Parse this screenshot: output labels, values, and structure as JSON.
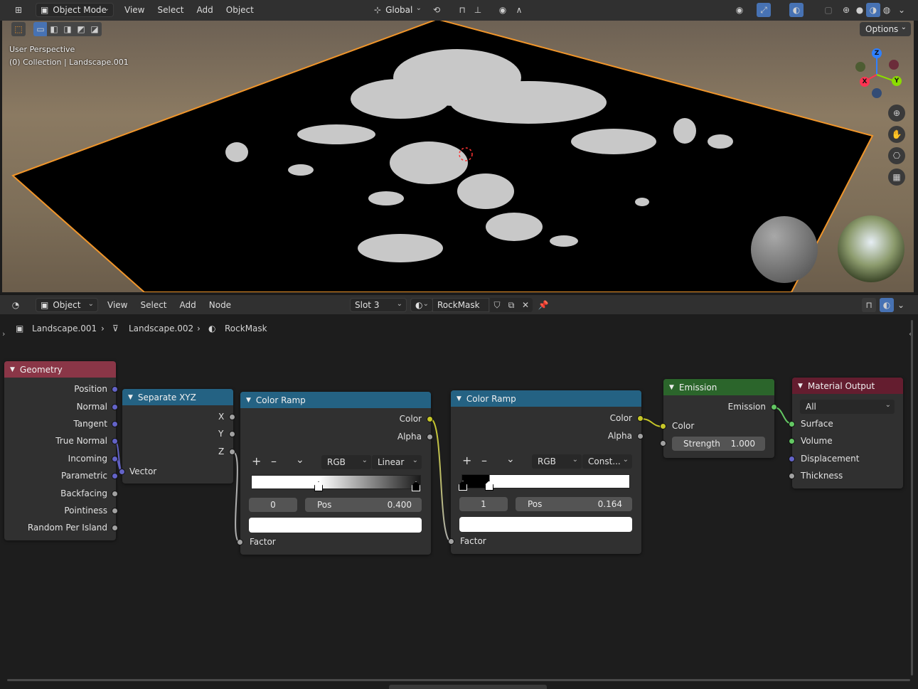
{
  "viewport_header": {
    "mode": "Object Mode",
    "menus": [
      "View",
      "Select",
      "Add",
      "Object"
    ],
    "orientation": "Global",
    "options": "Options"
  },
  "viewport": {
    "perspective": "User Perspective",
    "collection": "(0) Collection | Landscape.001",
    "gizmo": {
      "x": "X",
      "y": "Y",
      "z": "Z"
    }
  },
  "node_header": {
    "mode": "Object",
    "menus": [
      "View",
      "Select",
      "Add",
      "Node"
    ],
    "slot": "Slot 3",
    "material": "RockMask"
  },
  "breadcrumb": [
    "Landscape.001",
    "Landscape.002",
    "RockMask"
  ],
  "nodes": {
    "geometry": {
      "title": "Geometry",
      "outputs": [
        "Position",
        "Normal",
        "Tangent",
        "True Normal",
        "Incoming",
        "Parametric",
        "Backfacing",
        "Pointiness",
        "Random Per Island"
      ]
    },
    "separate_xyz": {
      "title": "Separate XYZ",
      "outputs": [
        "X",
        "Y",
        "Z"
      ],
      "input": "Vector"
    },
    "color_ramp_1": {
      "title": "Color Ramp",
      "out_color": "Color",
      "out_alpha": "Alpha",
      "mode": "RGB",
      "interp": "Linear",
      "index": "0",
      "pos_label": "Pos",
      "pos": "0.400",
      "input": "Factor",
      "plus": "+",
      "minus": "–",
      "down": "⌄"
    },
    "color_ramp_2": {
      "title": "Color Ramp",
      "out_color": "Color",
      "out_alpha": "Alpha",
      "mode": "RGB",
      "interp": "Const...",
      "index": "1",
      "pos_label": "Pos",
      "pos": "0.164",
      "input": "Factor",
      "plus": "+",
      "minus": "–",
      "down": "⌄"
    },
    "emission": {
      "title": "Emission",
      "output": "Emission",
      "in_color": "Color",
      "strength_label": "Strength",
      "strength": "1.000"
    },
    "material_output": {
      "title": "Material Output",
      "target": "All",
      "inputs": [
        "Surface",
        "Volume",
        "Displacement",
        "Thickness"
      ]
    }
  },
  "colors": {
    "geometry_header": "#8a3647",
    "converter_header": "#246283",
    "shader_header": "#2b652b",
    "output_header": "#641d2f",
    "socket_vector": "#6363c7",
    "socket_color": "#c7c729",
    "socket_float": "#a1a1a1",
    "socket_shader": "#63c763",
    "selection_outline": "#f0952a"
  }
}
